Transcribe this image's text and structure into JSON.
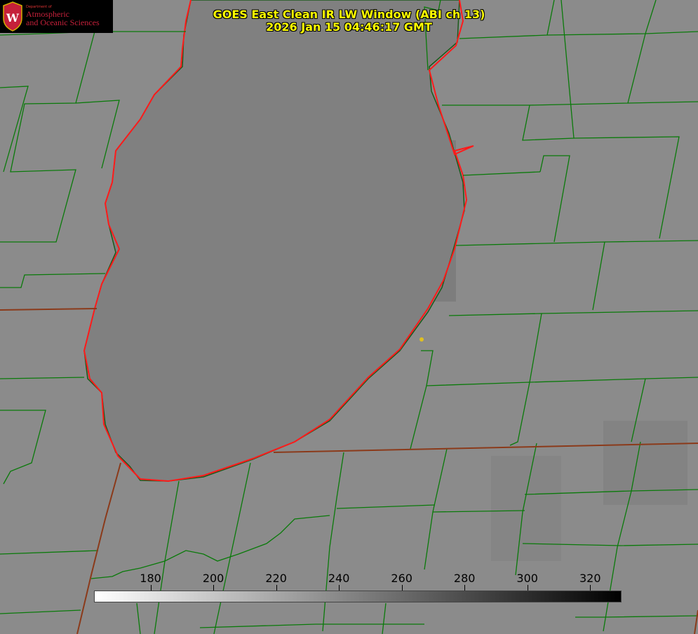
{
  "title": {
    "line1": "GOES East Clean IR LW Window (ABI ch 13)",
    "line2": "2026 Jan 15 04:46:17 GMT"
  },
  "logo": {
    "dept": "Department of",
    "name_line1": "Atmospheric",
    "name_line2": "and Oceanic Sciences",
    "seal_letter": "W",
    "seal_icon": "uw-crest-icon"
  },
  "colorbar": {
    "units_min": 162,
    "units_max": 330,
    "ticks": [
      "180",
      "200",
      "220",
      "240",
      "260",
      "280",
      "300",
      "320"
    ],
    "colors": {
      "low": "#ffffff",
      "high": "#000000"
    }
  },
  "map": {
    "background": "#8a8a8a",
    "lake_fill": "#7e7e7e",
    "county_color": "#0a7a0a",
    "state_color": "#8b3a1a",
    "shore_color": "#ff1010",
    "marker_color": "#e0c020"
  }
}
